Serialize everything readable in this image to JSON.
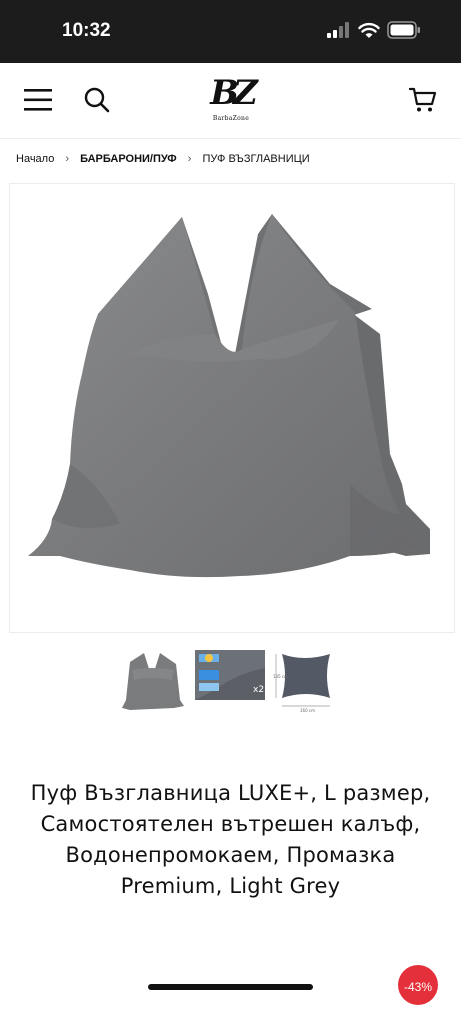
{
  "status_bar": {
    "time": "10:32"
  },
  "header": {
    "logo_mark": "BZ",
    "logo_text": "BarbaZone"
  },
  "breadcrumb": {
    "items": [
      "Начало",
      "БАРБАРОНИ/ПУФ",
      "ПУФ ВЪЗГЛАВНИЦИ"
    ],
    "separator": "›"
  },
  "thumbnails": {
    "dimension_height": "135 cm",
    "dimension_width": "160 cm",
    "count_label": "x2"
  },
  "product": {
    "title": "Пуф Възглавница LUXE+, L размер, Самостоятелен вътрешен калъф, Водонепромокаем, Промазка Premium, Light Grey",
    "discount_badge": "-43%"
  },
  "colors": {
    "status_bar_bg": "#1c1c1c",
    "product_grey": "#7b7c7e",
    "badge_red": "#e3303a"
  }
}
